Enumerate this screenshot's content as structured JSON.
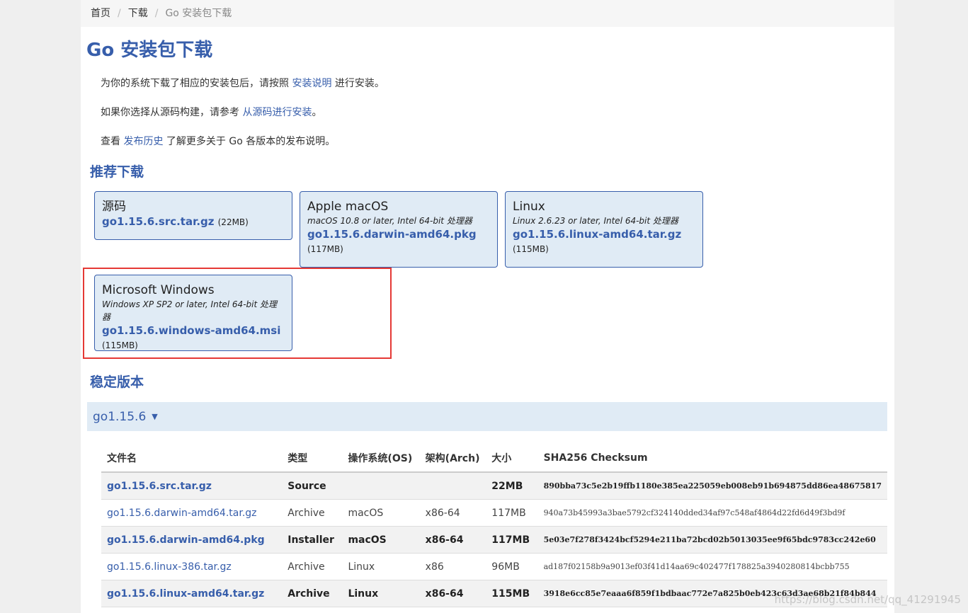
{
  "breadcrumb": {
    "home": "首页",
    "downloads": "下载",
    "current": "Go 安装包下载"
  },
  "title": "Go 安装包下载",
  "intro": {
    "p1_pre": "为你的系统下载了相应的安装包后，请按照 ",
    "p1_link": "安装说明",
    "p1_post": " 进行安装。",
    "p2_pre": "如果你选择从源码构建，请参考 ",
    "p2_link": "从源码进行安装",
    "p2_post": "。",
    "p3_pre": "查看 ",
    "p3_link": "发布历史",
    "p3_post": " 了解更多关于 Go 各版本的发布说明。"
  },
  "featured": {
    "heading": "推荐下载",
    "source": {
      "os": "源码",
      "file": "go1.15.6.src.tar.gz",
      "size": "(22MB)"
    },
    "mac": {
      "os": "Apple macOS",
      "req": "macOS 10.8 or later, Intel 64-bit 处理器",
      "file": "go1.15.6.darwin-amd64.pkg",
      "size": "(117MB)"
    },
    "linux": {
      "os": "Linux",
      "req": "Linux 2.6.23 or later, Intel 64-bit 处理器",
      "file": "go1.15.6.linux-amd64.tar.gz",
      "size": "(115MB)"
    },
    "windows": {
      "os": "Microsoft Windows",
      "req": "Windows XP SP2 or later, Intel 64-bit 处理器",
      "file": "go1.15.6.windows-amd64.msi",
      "size": "(115MB)"
    }
  },
  "stable": {
    "heading": "稳定版本",
    "version": "go1.15.6",
    "arrow": "▼",
    "columns": [
      "文件名",
      "类型",
      "操作系统(OS)",
      "架构(Arch)",
      "大小",
      "SHA256 Checksum"
    ],
    "rows": [
      {
        "file": "go1.15.6.src.tar.gz",
        "kind": "Source",
        "os": "",
        "arch": "",
        "size": "22MB",
        "sha": "890bba73c5e2b19ffb1180e385ea225059eb008eb91b694875dd86ea48675817"
      },
      {
        "file": "go1.15.6.darwin-amd64.tar.gz",
        "kind": "Archive",
        "os": "macOS",
        "arch": "x86-64",
        "size": "117MB",
        "sha": "940a73b45993a3bae5792cf324140dded34af97c548af4864d22fd6d49f3bd9f"
      },
      {
        "file": "go1.15.6.darwin-amd64.pkg",
        "kind": "Installer",
        "os": "macOS",
        "arch": "x86-64",
        "size": "117MB",
        "sha": "5e03e7f278f3424bcf5294e211ba72bcd02b5013035ee9f65bdc9783cc242e60"
      },
      {
        "file": "go1.15.6.linux-386.tar.gz",
        "kind": "Archive",
        "os": "Linux",
        "arch": "x86",
        "size": "96MB",
        "sha": "ad187f02158b9a9013ef03f41d14aa69c402477f178825a3940280814bcbb755"
      },
      {
        "file": "go1.15.6.linux-amd64.tar.gz",
        "kind": "Archive",
        "os": "Linux",
        "arch": "x86-64",
        "size": "115MB",
        "sha": "3918e6cc85e7eaaa6f859f1bdbaac772e7a825b0eb423c63d3ae68b21f84b844"
      }
    ]
  },
  "watermark": "https://blog.csdn.net/qq_41291945"
}
